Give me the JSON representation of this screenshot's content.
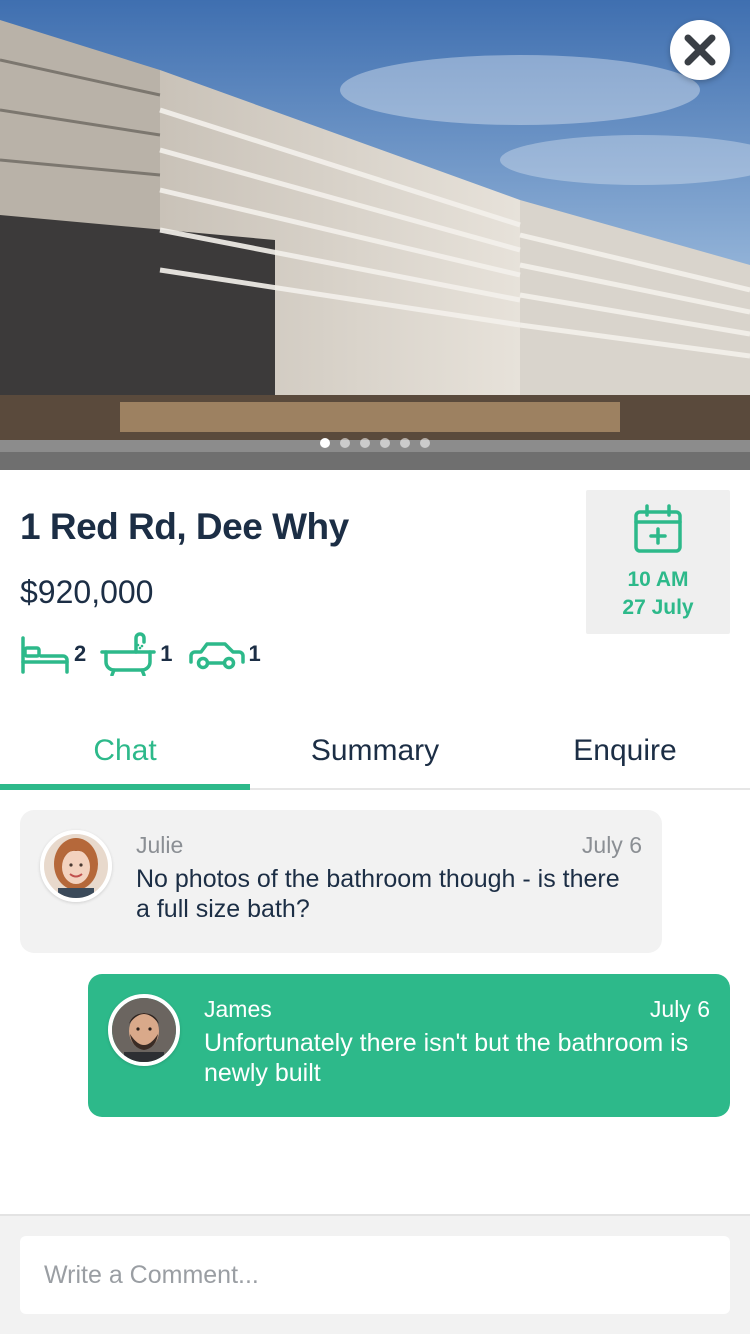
{
  "listing": {
    "address": "1 Red Rd, Dee Why",
    "price": "$920,000",
    "features": [
      {
        "icon": "bed-icon",
        "count": "2"
      },
      {
        "icon": "bath-icon",
        "count": "1"
      },
      {
        "icon": "car-icon",
        "count": "1"
      }
    ]
  },
  "inspection": {
    "time": "10 AM",
    "date": "27 July"
  },
  "gallery": {
    "slide_count": 6,
    "active_slide": 1
  },
  "tabs": [
    {
      "label": "Chat",
      "active": true
    },
    {
      "label": "Summary",
      "active": false
    },
    {
      "label": "Enquire",
      "active": false
    }
  ],
  "messages": [
    {
      "author": "Julie",
      "date": "July 6",
      "text": "No photos of the bathroom though - is there a full size bath?",
      "direction": "incoming"
    },
    {
      "author": "James",
      "date": "July 6",
      "text": "Unfortunately there isn't but the bathroom is newly built",
      "direction": "outgoing"
    }
  ],
  "composer": {
    "placeholder": "Write a Comment..."
  },
  "colors": {
    "accent": "#2db98a",
    "text_dark": "#1c2e45",
    "muted": "#8b8f94",
    "bubble_gray": "#f2f2f2"
  }
}
